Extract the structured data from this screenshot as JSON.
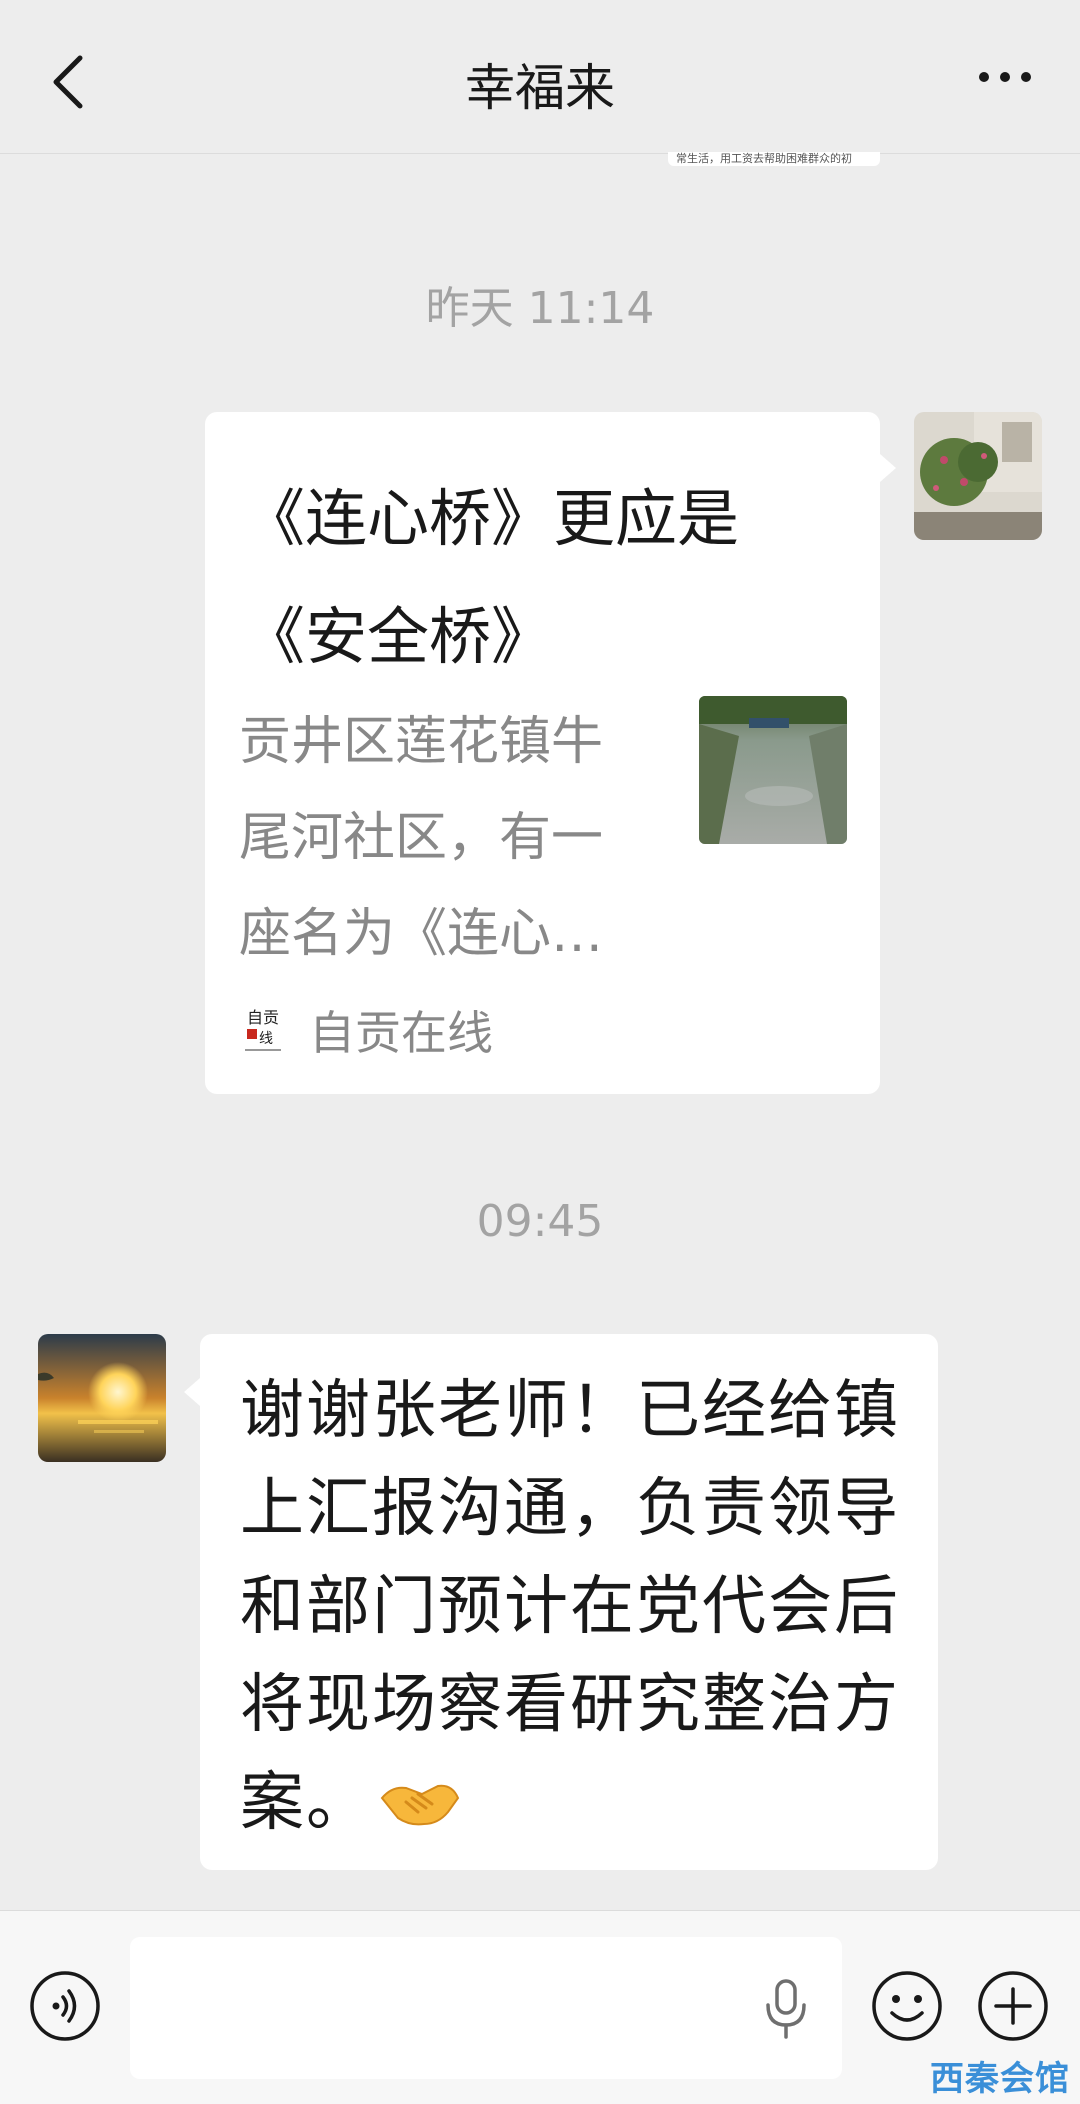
{
  "header": {
    "title": "幸福来",
    "back_icon": "chevron-left-icon",
    "more_icon": "more-dots-icon"
  },
  "prev_message_fragment": "常生活，用工资去帮助困难群众的初",
  "messages": [
    {
      "timestamp": "昨天 11:14",
      "type": "link-card",
      "side": "right",
      "title": "《连心桥》更应是《安全桥》",
      "description": "贡井区莲花镇牛尾河社区，有一座名为《连心…",
      "source": "自贡在线"
    },
    {
      "timestamp": "09:45",
      "type": "text",
      "side": "left",
      "text": "谢谢张老师！已经给镇上汇报沟通，负责领导和部门预计在党代会后将现场察看研究整治方案。",
      "emoji": "handshake-icon"
    }
  ],
  "input_bar": {
    "value": "",
    "voice_icon": "voice-icon",
    "mic_icon": "microphone-icon",
    "emoji_icon": "emoji-icon",
    "plus_icon": "plus-icon"
  },
  "watermark": "西秦会馆",
  "colors": {
    "background": "#ededed",
    "bubble": "#ffffff",
    "timestamp": "#a3a3a3",
    "watermark_a": "#e8b52a",
    "watermark_b": "#3a8fd8"
  }
}
